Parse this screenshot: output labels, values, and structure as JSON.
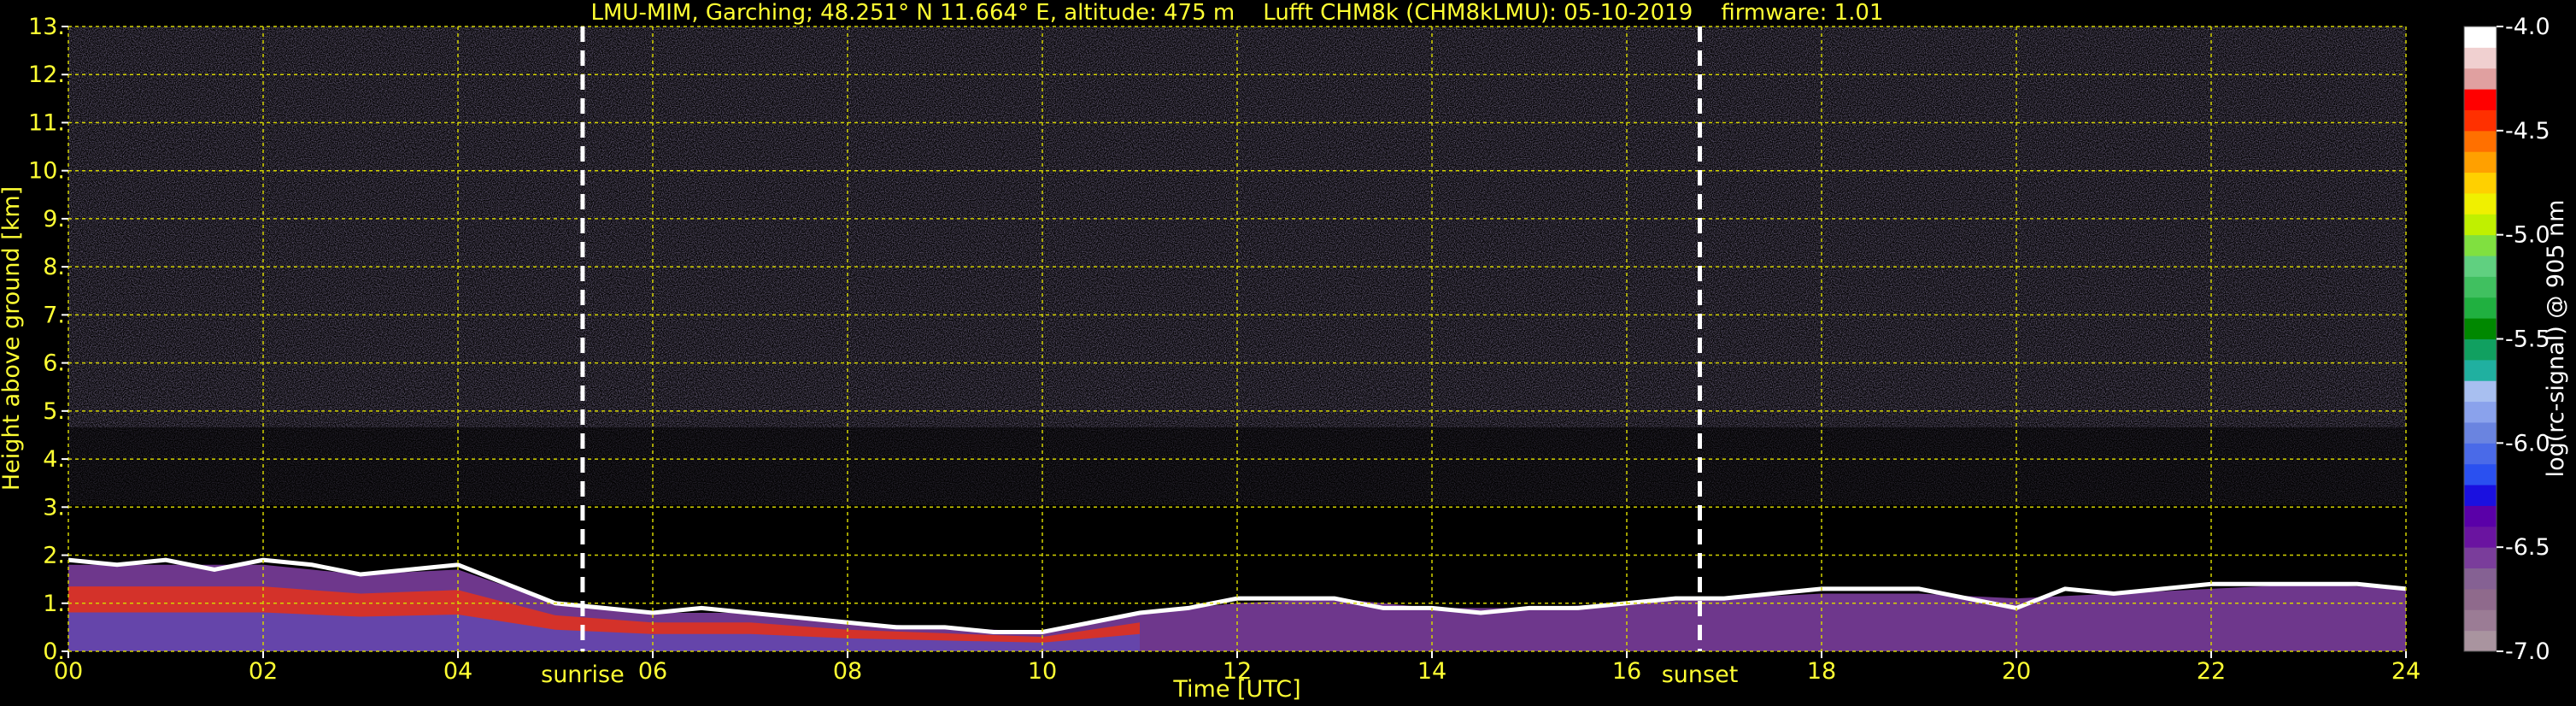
{
  "chart_data": {
    "type": "heatmap",
    "title": "LMU-MIM, Garching; 48.251° N 11.664° E, altitude: 475 m    Lufft CHM8k (CHM8kLMU): 05-10-2019    firmware: 1.01",
    "xlabel": "Time [UTC]",
    "ylabel": "Height above ground [km]",
    "xlim": [
      0,
      24
    ],
    "ylim": [
      0,
      13
    ],
    "x_ticks": [
      "00",
      "02",
      "04",
      "06",
      "08",
      "10",
      "12",
      "14",
      "16",
      "18",
      "20",
      "22",
      "24"
    ],
    "y_ticks": [
      "0.",
      "1.",
      "2.",
      "3.",
      "4.",
      "5.",
      "6.",
      "7.",
      "8.",
      "9.",
      "10.",
      "11.",
      "12.",
      "13."
    ],
    "grid": true,
    "grid_color": "#d4d400",
    "events": [
      {
        "label": "sunrise",
        "x": 5.28
      },
      {
        "label": "sunset",
        "x": 16.75
      }
    ],
    "colorbar": {
      "label": "log(rc-signal) @ 905 nm",
      "range": [
        -7.0,
        -4.0
      ],
      "ticks": [
        "-4.0",
        "-4.5",
        "-5.0",
        "-5.5",
        "-6.0",
        "-6.5",
        "-7.0"
      ],
      "colors": [
        "#a9949f",
        "#9b7c95",
        "#8f6a8c",
        "#856193",
        "#7a3d9b",
        "#6a14a0",
        "#5a00a8",
        "#1a10e0",
        "#2a50f0",
        "#4a6ae8",
        "#6a84e0",
        "#8aa2ec",
        "#a8bff0",
        "#20b0a0",
        "#10a060",
        "#008800",
        "#20b040",
        "#40c060",
        "#60d080",
        "#80e040",
        "#c0f000",
        "#f0f000",
        "#ffd000",
        "#ffa000",
        "#ff7000",
        "#ff3000",
        "#ff0000",
        "#e0a0a0",
        "#f0d0d0",
        "#ffffff"
      ]
    },
    "boundary_layer_top": {
      "x": [
        0,
        0.5,
        1,
        1.5,
        2,
        2.5,
        3,
        3.5,
        4,
        4.5,
        5,
        5.5,
        6,
        6.5,
        7,
        7.5,
        8,
        8.5,
        9,
        9.5,
        10,
        10.5,
        11,
        11.5,
        12,
        12.5,
        13,
        13.5,
        14,
        14.5,
        15,
        15.5,
        16,
        16.5,
        17,
        17.5,
        18,
        18.5,
        19,
        19.5,
        20,
        20.5,
        21,
        21.5,
        22,
        22.5,
        23,
        23.5,
        24
      ],
      "y": [
        1.9,
        1.8,
        1.9,
        1.7,
        1.9,
        1.8,
        1.6,
        1.7,
        1.8,
        1.4,
        1.0,
        0.9,
        0.8,
        0.9,
        0.8,
        0.7,
        0.6,
        0.5,
        0.5,
        0.4,
        0.4,
        0.6,
        0.8,
        0.9,
        1.1,
        1.1,
        1.1,
        0.9,
        0.9,
        0.8,
        0.9,
        0.9,
        1.0,
        1.1,
        1.1,
        1.2,
        1.3,
        1.3,
        1.3,
        1.1,
        0.9,
        1.3,
        1.2,
        1.3,
        1.4,
        1.4,
        1.4,
        1.4,
        1.3
      ]
    },
    "aerosol_layer_depth": {
      "x": [
        0,
        1,
        2,
        3,
        4,
        5,
        6,
        7,
        8,
        9,
        10,
        11,
        12,
        13,
        14,
        15,
        16,
        17,
        18,
        19,
        20,
        21,
        22,
        23,
        24
      ],
      "y": [
        1.8,
        1.8,
        1.8,
        1.6,
        1.7,
        1.0,
        0.8,
        0.8,
        0.6,
        0.5,
        0.4,
        0.8,
        1.0,
        1.1,
        0.9,
        0.9,
        1.0,
        1.1,
        1.2,
        1.2,
        1.1,
        1.2,
        1.3,
        1.4,
        1.3
      ]
    }
  }
}
